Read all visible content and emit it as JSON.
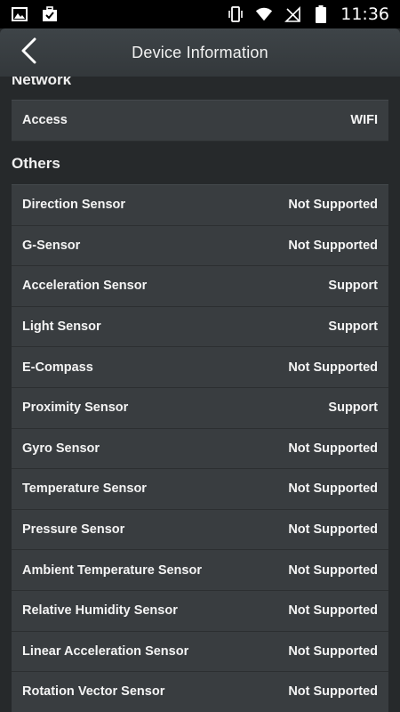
{
  "status_bar": {
    "time": "11:36",
    "icons_left": [
      "image-icon",
      "briefcase-check-icon"
    ],
    "icons_right": [
      "vibrate-icon",
      "wifi-icon",
      "no-sim-icon",
      "battery-icon"
    ]
  },
  "header": {
    "title": "Device Information",
    "back_icon": "chevron-left-icon"
  },
  "network": {
    "title": "Network",
    "rows": [
      {
        "label": "Access",
        "value": "WIFI"
      }
    ]
  },
  "others": {
    "title": "Others",
    "rows": [
      {
        "label": "Direction Sensor",
        "value": "Not Supported"
      },
      {
        "label": "G-Sensor",
        "value": "Not Supported"
      },
      {
        "label": "Acceleration Sensor",
        "value": "Support"
      },
      {
        "label": "Light Sensor",
        "value": "Support"
      },
      {
        "label": "E-Compass",
        "value": "Not Supported"
      },
      {
        "label": "Proximity Sensor",
        "value": "Support"
      },
      {
        "label": "Gyro Sensor",
        "value": "Not Supported"
      },
      {
        "label": "Temperature Sensor",
        "value": "Not Supported"
      },
      {
        "label": "Pressure Sensor",
        "value": "Not Supported"
      },
      {
        "label": "Ambient Temperature Sensor",
        "value": "Not Supported"
      },
      {
        "label": "Relative Humidity Sensor",
        "value": "Not Supported"
      },
      {
        "label": "Linear Acceleration Sensor",
        "value": "Not Supported"
      },
      {
        "label": "Rotation Vector Sensor",
        "value": "Not Supported"
      }
    ]
  },
  "colors": {
    "background": "#26292b",
    "row_background": "#393d40",
    "header_background": "#3a3f42",
    "text": "#f4f4f4"
  }
}
